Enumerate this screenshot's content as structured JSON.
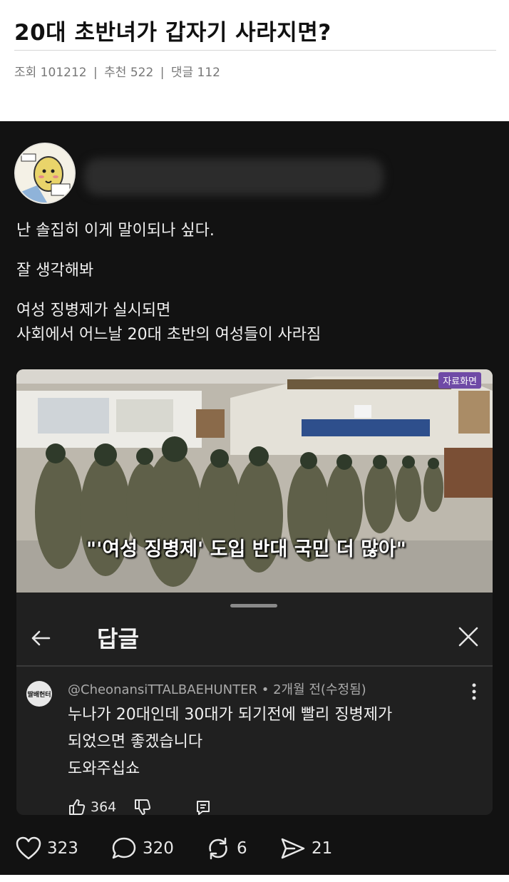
{
  "header": {
    "title": "20대 초반녀가 갑자기 사라지면?",
    "views": "조회 101212",
    "recommends": "추천 522",
    "comments": "댓글 112",
    "separator": "|"
  },
  "post": {
    "lines": [
      "난 솔집히 이게 말이되나 싶다.",
      "잘 생각해봐",
      "여성 징병제가 실시되면",
      "사회에서 어느날 20대 초반의 여성들이 사라짐"
    ],
    "video": {
      "source_badge": "자료화면",
      "caption": "\"'여성 징병제' 도입 반대 국민 더 많아\""
    },
    "reply_sheet": {
      "title": "답글",
      "avatar_text": "딸배헌터",
      "comment": {
        "handle": "@CheonansiTTALBAEHUNTER",
        "time": "• 2개월 전(수정됨)",
        "lines": [
          "누나가 20대인데 30대가 되기전에 빨리 징병제가",
          "되었으면 좋겠습니다",
          "도와주십쇼"
        ],
        "likes": "364"
      }
    },
    "footer": {
      "likes": "323",
      "replies": "320",
      "reposts": "6",
      "shares": "21"
    }
  },
  "colors": {
    "post_bg": "#121212",
    "sheet_bg": "#202020",
    "badge": "#6f4aa6"
  }
}
